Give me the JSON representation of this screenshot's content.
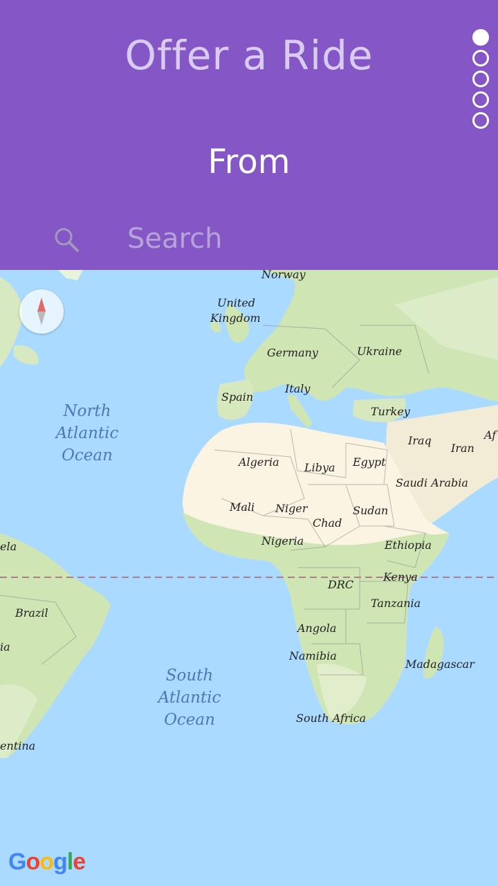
{
  "header": {
    "title": "Offer a Ride",
    "subtitle": "From",
    "page_indicator": {
      "total": 5,
      "current": 1
    }
  },
  "search": {
    "placeholder": "Search",
    "value": ""
  },
  "map": {
    "compass_icon": "compass-icon",
    "countries": [
      "Norway",
      "United",
      "Kingdom",
      "Germany",
      "Ukraine",
      "Italy",
      "Spain",
      "Turkey",
      "Iraq",
      "Iran",
      "Af",
      "Algeria",
      "Libya",
      "Egypt",
      "Saudi Arabia",
      "Mali",
      "Niger",
      "Chad",
      "Sudan",
      "Nigeria",
      "Ethiopia",
      "ela",
      "Kenya",
      "DRC",
      "Brazil",
      "Tanzania",
      "ia",
      "Angola",
      "Namibia",
      "Madagascar",
      "South Africa",
      "entina"
    ],
    "oceans": [
      "North\nAtlantic\nOcean",
      "South\nAtlantic\nOcean"
    ],
    "logo": "Google"
  },
  "colors": {
    "header_bg": "#8557c6",
    "water": "#aadaff",
    "land_green": "#cfe5b4",
    "land_desert": "#fbf4e3",
    "equator": "#b07a86"
  }
}
